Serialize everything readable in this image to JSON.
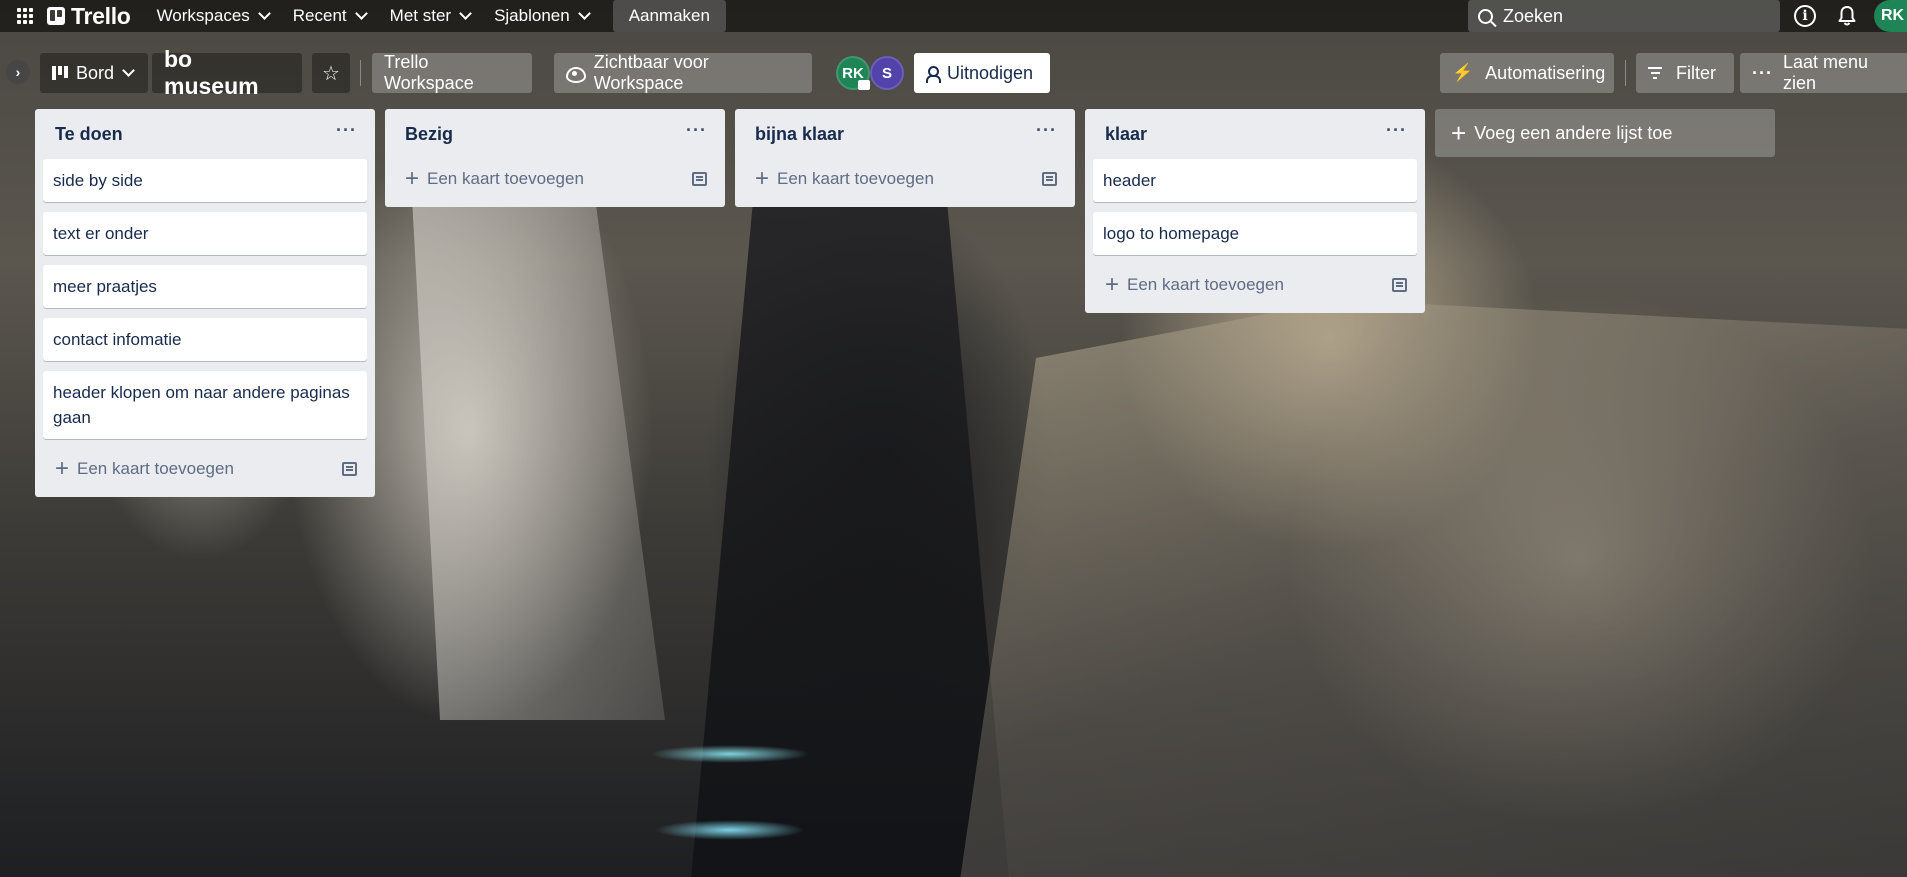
{
  "topbar": {
    "logo": "Trello",
    "nav": [
      "Workspaces",
      "Recent",
      "Met ster",
      "Sjablonen"
    ],
    "create": "Aanmaken",
    "search_placeholder": "Zoeken",
    "user_initials": "RK"
  },
  "board": {
    "view_label": "Bord",
    "title": "bo museum",
    "workspace": "Trello Workspace",
    "visibility": "Zichtbaar voor Workspace",
    "members": [
      "RK",
      "S"
    ],
    "invite": "Uitnodigen",
    "automation": "Automatisering",
    "filter": "Filter",
    "menu": "Laat menu zien"
  },
  "lists": [
    {
      "title": "Te doen",
      "cards": [
        "side by side",
        "text er onder",
        "meer praatjes",
        "contact infomatie",
        "header klopen om naar andere paginas gaan"
      ],
      "add_card": "Een kaart toevoegen"
    },
    {
      "title": "Bezig",
      "cards": [],
      "add_card": "Een kaart toevoegen"
    },
    {
      "title": "bijna klaar",
      "cards": [],
      "add_card": "Een kaart toevoegen"
    },
    {
      "title": "klaar",
      "cards": [
        "header",
        "logo to homepage"
      ],
      "add_card": "Een kaart toevoegen"
    }
  ],
  "add_list": "Voeg een andere lijst toe",
  "colors": {
    "avatar_rk": "#1f8456",
    "avatar_s": "#5243aa",
    "list_bg": "#ebecf0"
  }
}
